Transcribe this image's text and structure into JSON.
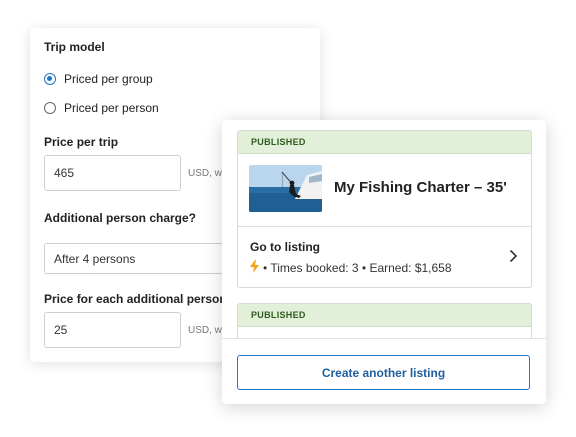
{
  "trip_form": {
    "trip_model_label": "Trip model",
    "options": [
      {
        "label": "Priced per group",
        "selected": true
      },
      {
        "label": "Priced per person",
        "selected": false
      }
    ],
    "price_per_trip_label": "Price per trip",
    "price_per_trip_value": "465",
    "price_suffix": "USD, wi",
    "additional_charge_label": "Additional person charge?",
    "additional_charge_value": "After 4 persons",
    "additional_price_label": "Price for each additional person",
    "additional_price_value": "25",
    "additional_price_suffix": "USD, wi"
  },
  "listings": [
    {
      "status": "PUBLISHED",
      "title": "My Fishing Charter – 35'",
      "goto_label": "Go to listing",
      "stats": "• Times booked: 3 • Earned: $1,658"
    },
    {
      "status": "PUBLISHED"
    }
  ],
  "actions": {
    "create_label": "Create another listing"
  },
  "colors": {
    "accent": "#1f76c6",
    "published_bg": "#e2f0d9",
    "bolt": "#f2a21b"
  },
  "icons": {
    "bolt": "lightning-bolt-icon",
    "chevron": "chevron-right-icon"
  }
}
